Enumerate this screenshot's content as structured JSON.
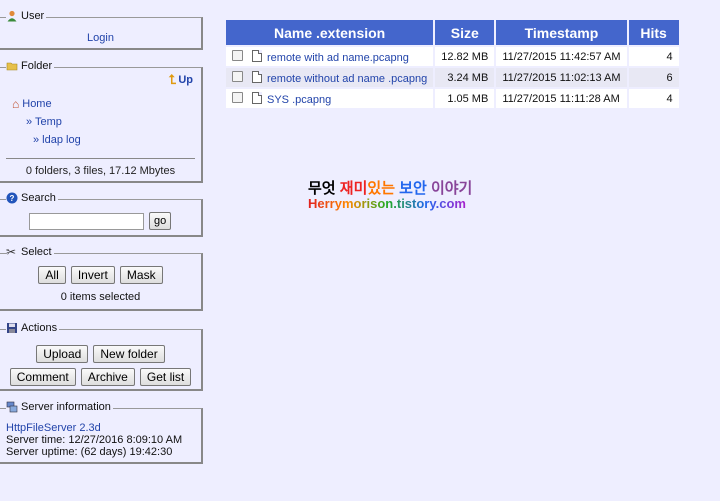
{
  "user": {
    "legend": "User",
    "login": "Login"
  },
  "folder": {
    "legend": "Folder",
    "up": "Up",
    "path": [
      "Home",
      "» Temp",
      "» ldap log"
    ],
    "summary": "0 folders, 3 files, 17.12 Mbytes"
  },
  "search": {
    "legend": "Search",
    "go": "go",
    "value": ""
  },
  "select": {
    "legend": "Select",
    "all": "All",
    "invert": "Invert",
    "mask": "Mask",
    "status": "0 items selected"
  },
  "actions": {
    "legend": "Actions",
    "upload": "Upload",
    "new_folder": "New folder",
    "comment": "Comment",
    "archive": "Archive",
    "get_list": "Get list"
  },
  "server": {
    "legend": "Server information",
    "name": "HttpFileServer 2.3d",
    "time": "Server time: 12/27/2016 8:09:10 AM",
    "uptime": "Server uptime: (62 days) 19:42:30"
  },
  "table": {
    "headers": [
      "Name .extension",
      "Size",
      "Timestamp",
      "Hits"
    ],
    "rows": [
      {
        "name": "remote with ad name.pcapng",
        "size": "12.82 MB",
        "timestamp": "11/27/2015 11:42:57 AM",
        "hits": "4"
      },
      {
        "name": "remote without ad name .pcapng",
        "size": "3.24 MB",
        "timestamp": "11/27/2015 11:02:13 AM",
        "hits": "6"
      },
      {
        "name": "SYS .pcapng",
        "size": "1.05 MB",
        "timestamp": "11/27/2015 11:11:28 AM",
        "hits": "4"
      }
    ]
  },
  "watermark": {
    "line1a": "무엇",
    "line1b": "재미",
    "line1c": "있는",
    "line1d": "보안",
    "line1e": "이야기",
    "line2": "Herrymorison.tistory.com"
  },
  "colors": {
    "header": "#4466cc",
    "background": "#eeeeff",
    "link": "#2244aa"
  }
}
